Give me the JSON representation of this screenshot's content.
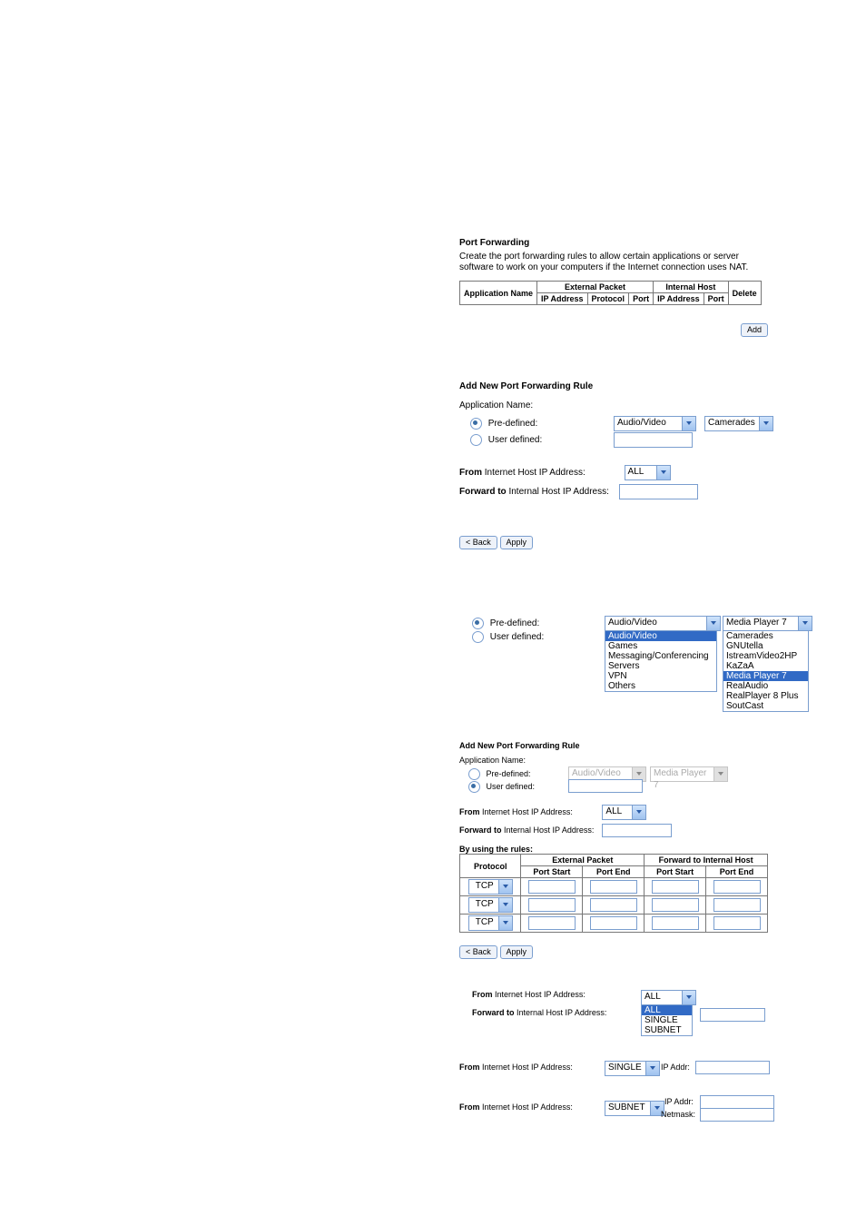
{
  "top": {
    "title": "Port Forwarding",
    "desc": "Create the port forwarding rules to allow certain applications or server software to work on your computers if the Internet connection uses NAT.",
    "table": {
      "col_app": "Application Name",
      "group_ext": "External Packet",
      "group_int": "Internal Host",
      "col_ip": "IP Address",
      "col_proto": "Protocol",
      "col_port": "Port",
      "col_delete": "Delete"
    },
    "add_btn": "Add"
  },
  "form1": {
    "title": "Add New Port Forwarding Rule",
    "app_name": "Application Name:",
    "predefined": "Pre-defined:",
    "userdefined": "User defined:",
    "sel1": "Audio/Video",
    "sel2": "Camerades",
    "from_label_strong": "From",
    "from_label_rest": " Internet Host IP Address:",
    "from_sel": "ALL",
    "fwd_label_strong": "Forward to",
    "fwd_label_rest": " Internal Host IP Address:",
    "back_btn": "< Back",
    "apply_btn": "Apply"
  },
  "examplelists": {
    "predefined": "Pre-defined:",
    "userdefined": "User defined:",
    "left_sel": "Audio/Video",
    "left_items": [
      "Audio/Video",
      "Games",
      "Messaging/Conferencing",
      "Servers",
      "VPN",
      "Others"
    ],
    "right_sel": "Media Player 7",
    "right_items": [
      "Camerades",
      "GNUtella",
      "IstreamVideo2HP",
      "KaZaA",
      "Media Player 7",
      "RealAudio",
      "RealPlayer 8 Plus",
      "SoutCast"
    ]
  },
  "form2": {
    "title": "Add New Port Forwarding Rule",
    "app_name": "Application Name:",
    "predefined": "Pre-defined:",
    "userdefined": "User defined:",
    "sel1": "Audio/Video",
    "sel2": "Media Player 7",
    "from_label_strong": "From",
    "from_label_rest": " Internet Host IP Address:",
    "from_sel": "ALL",
    "fwd_label_strong": "Forward to",
    "fwd_label_rest": " Internal Host IP Address:",
    "rules_title": "By using the rules:",
    "col_proto": "Protocol",
    "group_ext": "External Packet",
    "group_fwd": "Forward to Internal Host",
    "col_pstart": "Port Start",
    "col_pend": "Port End",
    "proto_val": "TCP",
    "back_btn": "< Back",
    "apply_btn": "Apply"
  },
  "fromexamples": {
    "from_strong": "From",
    "from_rest": " Internet Host IP Address:",
    "fwd_strong": "Forward to",
    "fwd_rest": " Internal Host IP Address:",
    "all_sel": "ALL",
    "all_items": [
      "ALL",
      "SINGLE",
      "SUBNET"
    ],
    "single_sel": "SINGLE",
    "ipaddr_label": "IP Addr:",
    "subnet_sel": "SUBNET",
    "netmask_label": "Netmask:"
  }
}
